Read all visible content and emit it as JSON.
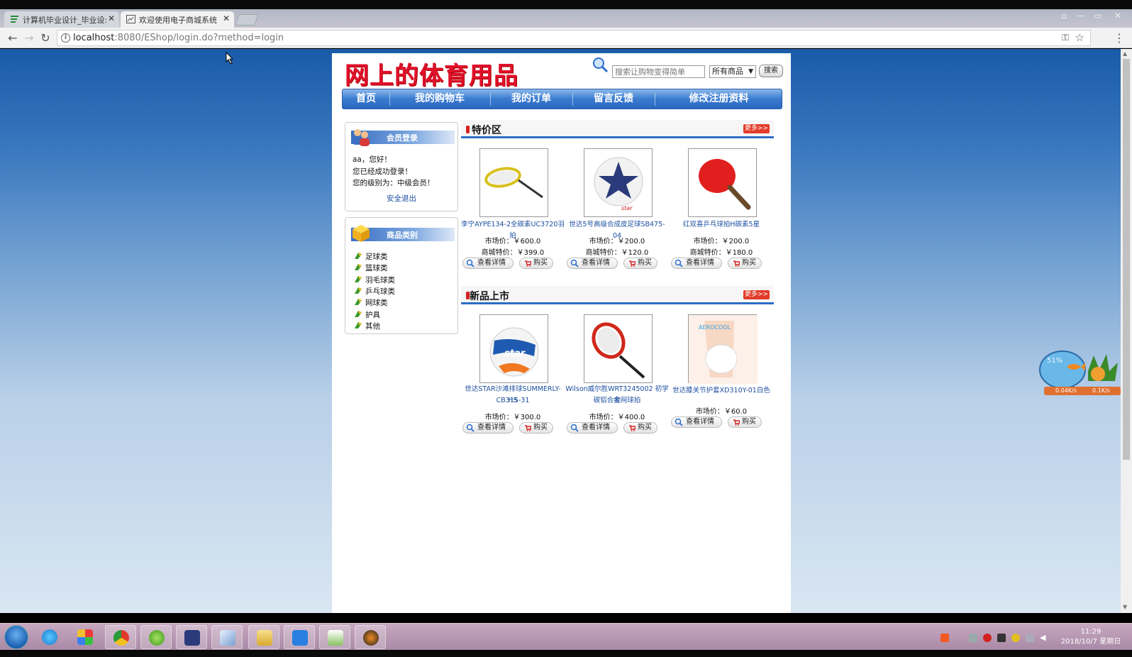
{
  "browser": {
    "tabs": [
      {
        "title": "计算机毕业设计_毕业设:"
      },
      {
        "title": "欢迎使用电子商城系统"
      }
    ],
    "url_host": "localhost",
    "url_rest": ":8080/EShop/login.do?method=login"
  },
  "header": {
    "logo": "网上的体育用品",
    "search_placeholder": "搜索让购物变得简单",
    "category_select": "所有商品",
    "search_button": "搜索"
  },
  "nav": {
    "items": [
      "首页",
      "我的购物车",
      "我的订单",
      "留言反馈",
      "修改注册资料"
    ]
  },
  "login_box": {
    "title": "会员登录",
    "greeting": "aa，您好！",
    "status": "您已经成功登录！",
    "level": "您的级别为：中级会员！",
    "logout": "安全退出"
  },
  "category_box": {
    "title": "商品类别",
    "items": [
      "足球类",
      "篮球类",
      "羽毛球类",
      "乒乓球类",
      "网球类",
      "护具",
      "其他"
    ]
  },
  "special": {
    "title": "特价区",
    "more": "更多>>",
    "products": [
      {
        "name": "李宁AYPE134-2全碳素UC3720羽拍",
        "market": "市场价：￥600.0",
        "mall": "商城特价：￥399.0",
        "detail": "查看详情",
        "buy": "购买"
      },
      {
        "name": "世达5号高级合成皮足球SB475-04",
        "market": "市场价：￥200.0",
        "mall": "商城特价：￥120.0",
        "detail": "查看详情",
        "buy": "购买"
      },
      {
        "name": "红双喜乒乓球拍H碳素5星",
        "market": "市场价：￥200.0",
        "mall": "商城特价：￥180.0",
        "detail": "查看详情",
        "buy": "购买"
      }
    ]
  },
  "newest": {
    "title": "新品上市",
    "more": "更多>>",
    "products": [
      {
        "name_l1": "世达STAR沙滩排球SUMMERLY-HS",
        "name_l2": "CB315-31",
        "market": "市场价：￥300.0",
        "detail": "查看详情",
        "buy": "购买"
      },
      {
        "name_l1": "Wilson威尔胜WRT3245002 初学者",
        "name_l2": "碳铝合金网球拍",
        "market": "市场价：￥400.0",
        "detail": "查看详情",
        "buy": "购买"
      },
      {
        "name_l1": "世达膝关节护套XD310Y-01白色",
        "market": "市场价：￥60.0",
        "detail": "查看详情",
        "buy": "购买"
      }
    ]
  },
  "widget": {
    "percent": "51%",
    "up": "0.04K/s",
    "down": "0.1K/s"
  },
  "taskbar": {
    "time": "11:29",
    "date": "2018/10/7 星期日"
  }
}
